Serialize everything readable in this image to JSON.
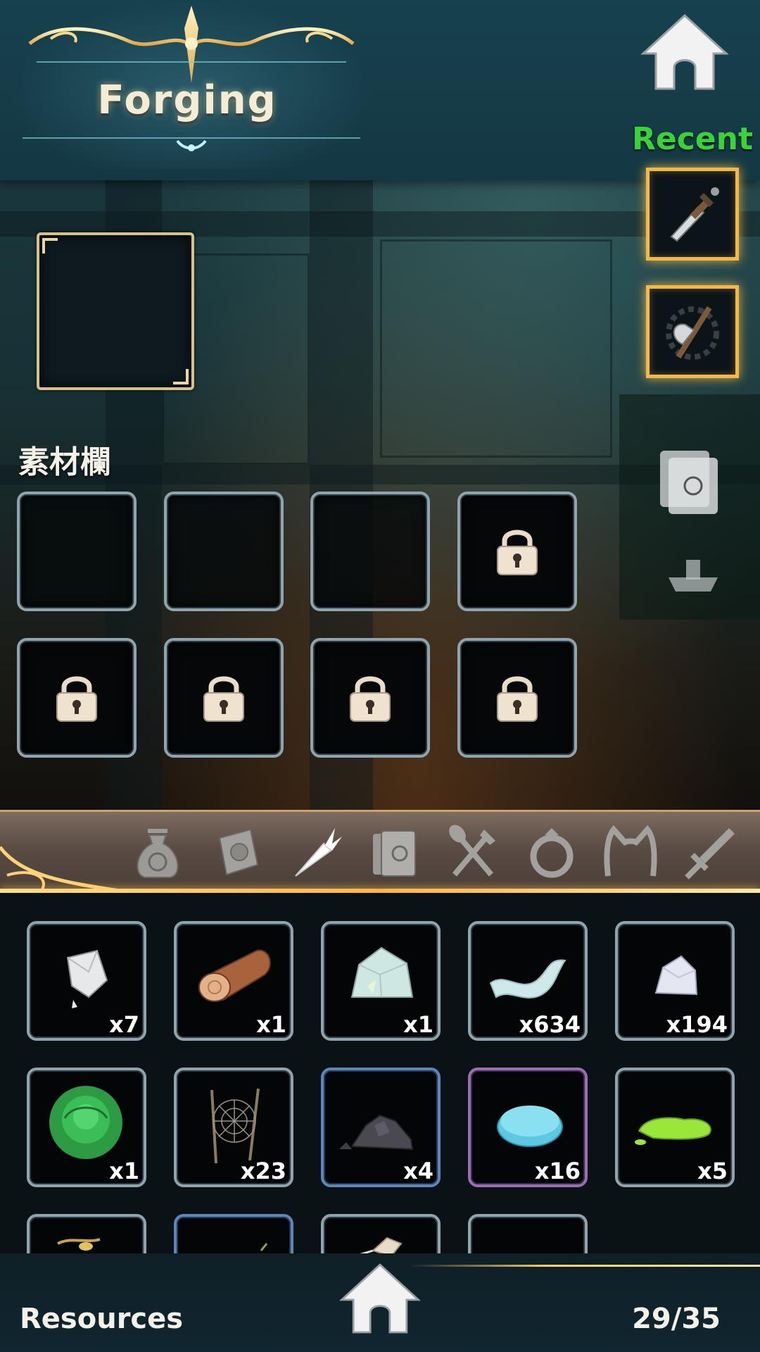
{
  "header": {
    "title": "Forging",
    "home_icon": "home-icon"
  },
  "recent": {
    "label": "Recent",
    "items": [
      {
        "icon": "dagger-icon"
      },
      {
        "icon": "axe-icon"
      }
    ]
  },
  "target_slot": {
    "icon": "empty-slot"
  },
  "materials": {
    "label": "素材欄",
    "slots": [
      {
        "locked": false
      },
      {
        "locked": false
      },
      {
        "locked": false
      },
      {
        "locked": true
      },
      {
        "locked": true
      },
      {
        "locked": true
      },
      {
        "locked": true
      },
      {
        "locked": true
      }
    ],
    "lock_icon": "padlock-icon"
  },
  "categories": {
    "items": [
      {
        "icon": "pouch-icon",
        "active": false
      },
      {
        "icon": "scroll-icon",
        "active": false
      },
      {
        "icon": "carrot-icon",
        "active": true
      },
      {
        "icon": "books-icon",
        "active": false
      },
      {
        "icon": "utensils-icon",
        "active": false
      },
      {
        "icon": "ring-icon",
        "active": false
      },
      {
        "icon": "cat-ears-icon",
        "active": false
      },
      {
        "icon": "sword-icon",
        "active": false
      }
    ]
  },
  "inventory": {
    "items": [
      {
        "icon": "quartz-crystal-icon",
        "count": "x7",
        "rarity": "common"
      },
      {
        "icon": "wood-log-icon",
        "count": "x1",
        "rarity": "common"
      },
      {
        "icon": "crystal-ore-icon",
        "count": "x1",
        "rarity": "common"
      },
      {
        "icon": "cloth-ribbon-icon",
        "count": "x634",
        "rarity": "common"
      },
      {
        "icon": "silver-ore-icon",
        "count": "x194",
        "rarity": "common"
      },
      {
        "icon": "green-rose-icon",
        "count": "x1",
        "rarity": "common"
      },
      {
        "icon": "spider-web-icon",
        "count": "x23",
        "rarity": "common"
      },
      {
        "icon": "coal-pile-icon",
        "count": "x4",
        "rarity": "rare"
      },
      {
        "icon": "slime-gel-icon",
        "count": "x16",
        "rarity": "epic"
      },
      {
        "icon": "green-slime-icon",
        "count": "x5",
        "rarity": "common"
      },
      {
        "icon": "partial-item-icon",
        "count": "",
        "rarity": "common"
      },
      {
        "icon": "partial-item-icon",
        "count": "",
        "rarity": "rare"
      },
      {
        "icon": "partial-item-icon",
        "count": "",
        "rarity": "common"
      },
      {
        "icon": "partial-item-icon",
        "count": "",
        "rarity": "common"
      }
    ]
  },
  "footer": {
    "label": "Resources",
    "capacity": "29/35",
    "home_icon": "home-icon"
  },
  "colors": {
    "accent_gold": "#f2b84a",
    "recent_green": "#3bd13b",
    "rare_blue": "#5f86b8",
    "epic_purple": "#9a6eb0"
  }
}
